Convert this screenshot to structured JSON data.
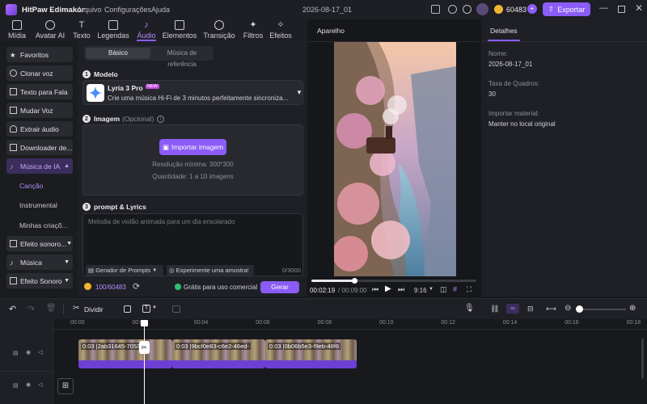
{
  "app": {
    "title": "HitPaw Edimakor",
    "menu": [
      "Arquivo",
      "Configurações",
      "Ajuda"
    ],
    "project_name": "2026-08-17_01",
    "credits": "60483",
    "export_label": "Exportar"
  },
  "tabs": [
    {
      "label": "Mídia"
    },
    {
      "label": "Avatar AI"
    },
    {
      "label": "Texto"
    },
    {
      "label": "Legendas"
    },
    {
      "label": "Áudio"
    },
    {
      "label": "Elementos"
    },
    {
      "label": "Transição"
    },
    {
      "label": "Filtros"
    },
    {
      "label": "Efeitos"
    }
  ],
  "sidebar": {
    "items": [
      "Favoritos",
      "Clonar voz",
      "Texto para Fala",
      "Mudar Voz",
      "Extrair áudio",
      "Downloader de...",
      "Música de IA",
      "Efeito sonoro...",
      "Música",
      "Efeito Sonoro"
    ],
    "subitems": [
      "Canção",
      "Instrumental",
      "Minhas criaçõ..."
    ]
  },
  "main": {
    "mode_tabs": [
      "Básico",
      "Música de referência"
    ],
    "model": {
      "title": "Modelo",
      "name": "Lyria 3 Pro",
      "badge": "NEW",
      "desc": "Crie uma música Hi-Fi de 3 minutos perfeitamente sincroniza..."
    },
    "image": {
      "title": "Imagem",
      "optional": "(Opcional)",
      "import_label": "Importar imagem",
      "resolution": "Resolução mínima: 300*300",
      "quantity": "Quantidade: 1 a 10 imagens"
    },
    "prompt": {
      "title": "prompt & Lyrics",
      "placeholder": "Melodia de violão animada para um dia ensolarado",
      "prompt_gen": "Gerador de Prompts",
      "try_sample": "Experimente uma amostra!",
      "counter": "0/3000"
    },
    "footer": {
      "credits": "100/60483",
      "commercial": "Grátis para uso comercial",
      "generate": "Gerar"
    }
  },
  "preview": {
    "title": "Aparelho",
    "current_time": "00:02:19",
    "total_time": "/ 00:09:00",
    "ratio": "9:16",
    "progress": 0.26
  },
  "details": {
    "tab": "Detalhes",
    "name_label": "Nome:",
    "name_value": "2026-08-17_01",
    "fps_label": "Taxa de Quadros:",
    "fps_value": "30",
    "import_label": "Importar material:",
    "import_value": "Manter no local original"
  },
  "toolbar": {
    "split_label": "Dividir"
  },
  "timeline": {
    "ruler": [
      "00:00",
      "00:02",
      "00:04",
      "00:06",
      "00:08",
      "00:10",
      "00:12",
      "00:14",
      "00:16",
      "00:18"
    ],
    "clips": [
      "0:03 |2ab31645-7053-",
      "0:03 |9bcf0e83-c6e2-46ed-",
      "0:03 |0b06b5e3-f9eb-48f6"
    ],
    "playhead_time": 2.19
  },
  "colors": {
    "accent": "#8b5cf6",
    "background": "#17181c"
  }
}
